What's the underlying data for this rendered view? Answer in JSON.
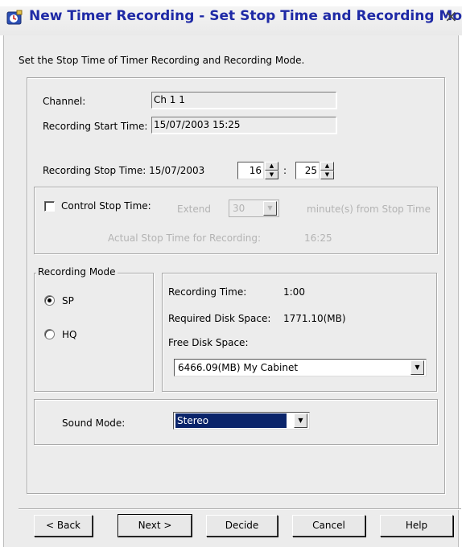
{
  "window": {
    "title": "New Timer Recording - Set Stop Time and Recording Mode",
    "close_glyph": "×"
  },
  "instruction": "Set the Stop Time of Timer Recording and Recording Mode.",
  "channel": {
    "label": "Channel:",
    "value": "Ch 1 1"
  },
  "start_time": {
    "label": "Recording Start Time:",
    "value": "15/07/2003 15:25"
  },
  "stop_time": {
    "label": "Recording Stop Time: 15/07/2003",
    "hour": "16",
    "separator": ":",
    "minute": "25"
  },
  "control_stop": {
    "label": "Control Stop Time:",
    "checked": false,
    "extend_label": "Extend",
    "extend_value": "30",
    "suffix": "minute(s) from Stop Time",
    "actual_label": "Actual Stop Time for Recording:",
    "actual_value": "16:25"
  },
  "recording_mode": {
    "legend": "Recording Mode",
    "options": [
      {
        "label": "SP",
        "selected": true
      },
      {
        "label": "HQ",
        "selected": false
      }
    ]
  },
  "info": {
    "recording_time_label": "Recording Time:",
    "recording_time_value": "1:00",
    "disk_space_label": "Required Disk Space:",
    "disk_space_value": "1771.10(MB)",
    "free_space_label": "Free Disk Space:",
    "free_space_value": "6466.09(MB) My Cabinet"
  },
  "sound": {
    "label": "Sound Mode:",
    "value": "Stereo"
  },
  "buttons": {
    "back": "< Back",
    "next": "Next >",
    "decide": "Decide",
    "cancel": "Cancel",
    "help": "Help"
  },
  "colors": {
    "title_text": "#1f2aa6",
    "dialog_bg": "#ececec",
    "selection": "#0a246a"
  }
}
